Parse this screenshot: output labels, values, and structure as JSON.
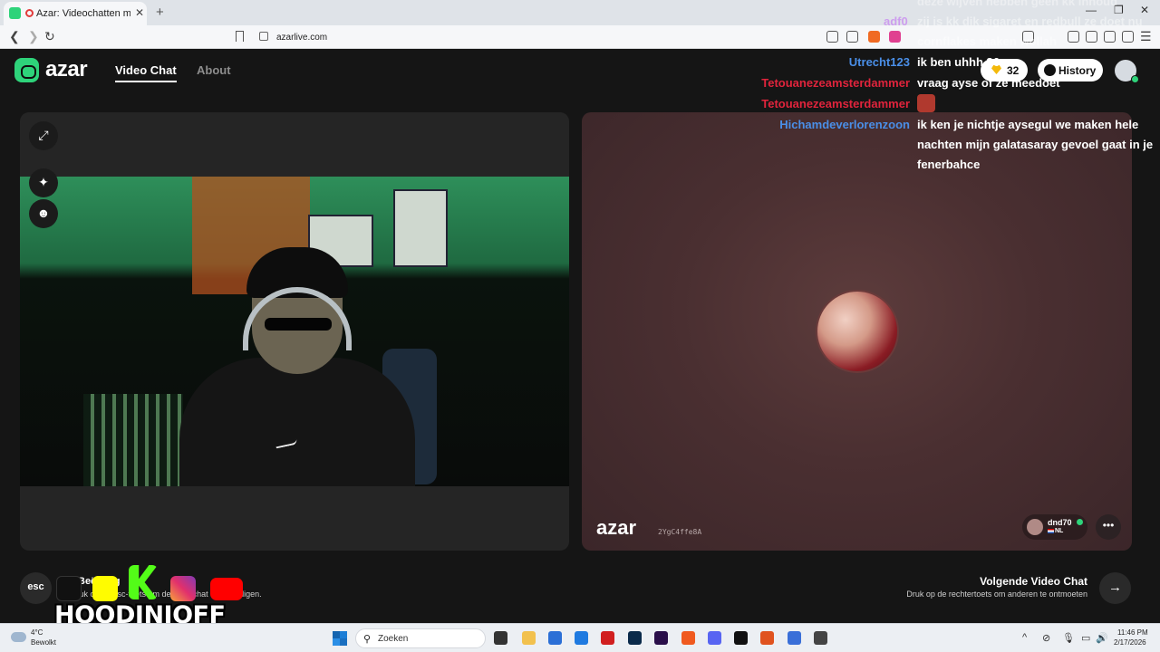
{
  "browser": {
    "tab_title": "Azar: Videochatten met nieuwe",
    "url": "azarlive.com"
  },
  "header": {
    "brand": "azar",
    "nav": [
      "Video Chat",
      "About"
    ],
    "gems": "32",
    "history_label": "History"
  },
  "chat": [
    {
      "name": "Utrecht123",
      "text": "ik ben uhhh 36",
      "color": "#4a8fe8"
    },
    {
      "name": "Tetouanezeamsterdammer",
      "text": "vraag ayse of ze meedoet",
      "color": "#e0243c"
    },
    {
      "name": "Tetouanezeamsterdammer",
      "text": "",
      "color": "#e0243c"
    },
    {
      "name": "Hichamdeverlorenzoon",
      "text": "ik ken je nichtje aysegul we maken hele",
      "color": "#4a8fe8"
    },
    {
      "name": "",
      "text": "nachten mijn galatasaray gevoel gaat in je",
      "color": "#ffffff"
    },
    {
      "name": "",
      "text": "fenerbahce",
      "color": "#ffffff"
    }
  ],
  "chat_faded": [
    {
      "name": "adf0",
      "text": "zij is kk dik sigaret en redbull ze doet nu"
    },
    {
      "name": "",
      "text": "cornflakes maken wollah"
    },
    {
      "name": "",
      "text": "deze wijven hebben geen kk inhoud"
    }
  ],
  "partner": {
    "brand": "azar",
    "code": "2YgC4ffe8A",
    "username": "dnd70",
    "country": "NL"
  },
  "bottom": {
    "esc_key": "esc",
    "esc_title": "Beëindig",
    "esc_subtitle": "Druk op de esc-toets om de videochat te beëindigen.",
    "next_title": "Volgende Video Chat",
    "next_subtitle": "Druk op de rechtertoets om anderen te ontmoeten"
  },
  "overlay": {
    "handle": "HOODINIOFF"
  },
  "taskbar": {
    "temperature": "4°C",
    "condition": "Bewolkt",
    "search_placeholder": "Zoeken",
    "time": "11:46 PM",
    "date": "2/17/2026"
  },
  "colors": {
    "brand_green": "#2ed37a",
    "username_blue": "#4a8fe8",
    "username_red": "#e0243c"
  }
}
